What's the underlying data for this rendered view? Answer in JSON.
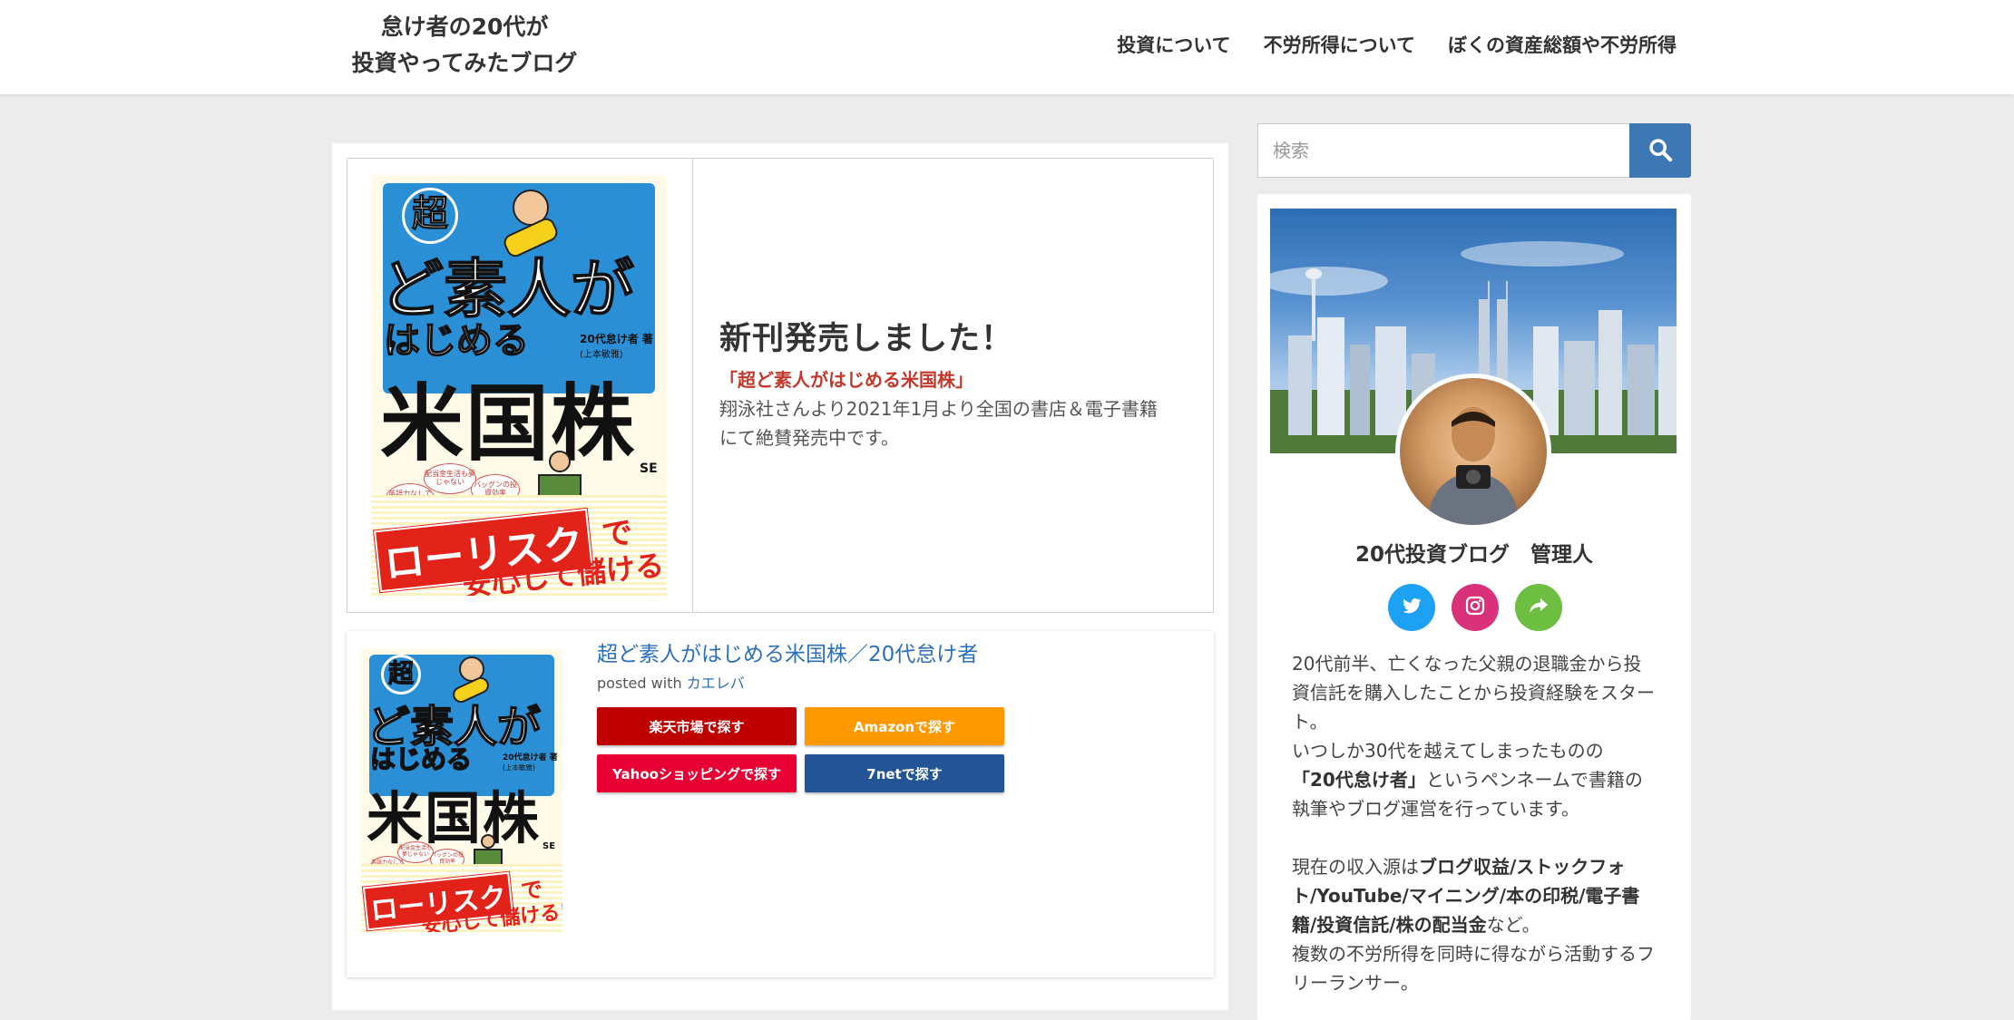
{
  "header": {
    "logo_line1": "怠け者の20代が",
    "logo_line2": "投資やってみたブログ",
    "nav": [
      "投資について",
      "不労所得について",
      "ぼくの資産総額や不労所得"
    ]
  },
  "release": {
    "heading": "新刊発売しました！",
    "book_title": "「超ど素人がはじめる米国株」",
    "desc_line1": "翔泳社さんより2021年1月より全国の書店＆電子書籍",
    "desc_line2": "にて絶賛発売中です。"
  },
  "book_cover": {
    "super": "超",
    "line1": "ど素人が",
    "line2": "はじめる",
    "author": "20代怠け者",
    "author_suffix": "著",
    "supervisor": "(上本敏雅)",
    "kanji": "米国株",
    "publisher_mark": "SE",
    "bubble1": "英語力なしでもOK",
    "bubble2": "配当金生活も夢じゃない",
    "bubble3": "バッグンの投資効率",
    "lowrisk": "ローリスク",
    "de": "で",
    "anshin": "安心して儲ける!"
  },
  "product": {
    "title": "超ど素人がはじめる米国株／20代怠け者",
    "posted_prefix": "posted with",
    "posted_link": "カエレバ",
    "buttons": [
      {
        "label": "楽天市場で探す",
        "color": "#bf0000"
      },
      {
        "label": "Amazonで探す",
        "color": "#ff9901"
      },
      {
        "label": "Yahooショッピングで探す",
        "color": "#e60033"
      },
      {
        "label": "7netで探す",
        "color": "#225496"
      }
    ]
  },
  "search": {
    "placeholder": "検索"
  },
  "profile": {
    "name": "20代投資ブログ　管理人",
    "sns": [
      {
        "icon": "twitter-icon",
        "color": "#1da1f2"
      },
      {
        "icon": "instagram-icon",
        "color": "#d9317a"
      },
      {
        "icon": "share-icon",
        "color": "#6cbf41"
      }
    ],
    "bio1": "20代前半、亡くなった父親の退職金から投資信託を購入したことから投資経験をスタート。",
    "bio2": "いつしか30代を越えてしまったものの",
    "bio3_bold": "「20代怠け者」",
    "bio3_rest": "というペンネームで書籍の執筆やブログ運営を行っています。",
    "bio4_prefix": "現在の収入源は",
    "bio4_bold": "ブログ収益/ストックフォト/YouTube/マイニング/本の印税/電子書籍/投資信託/株の配当金",
    "bio4_suffix": "など。",
    "bio5": "複数の不労所得を同時に得ながら活動するフリーランサー。"
  }
}
